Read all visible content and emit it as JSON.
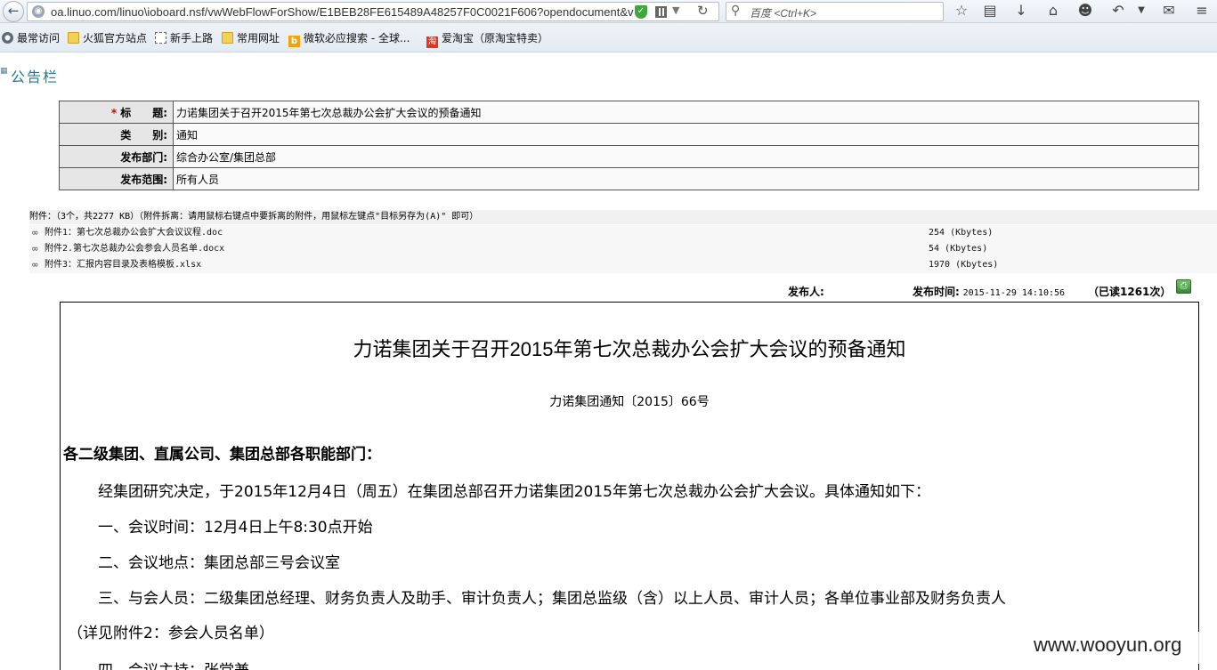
{
  "browser": {
    "url": "oa.linuo.com/linuo\\ioboard.nsf/vwWebFlowForShow/E1BEB28FE615489A48257F0C0021F606?opendocument&v",
    "search_placeholder": "百度 <Ctrl+K>",
    "bookmarks": [
      {
        "label": "最常访问",
        "icon": "gear-icon"
      },
      {
        "label": "火狐官方站点",
        "icon": "folder-icon"
      },
      {
        "label": "新手上路",
        "icon": "page-icon"
      },
      {
        "label": "常用网址",
        "icon": "folder-icon"
      },
      {
        "label": "微软必应搜索 - 全球...",
        "icon": "bing-icon"
      },
      {
        "label": "爱淘宝（原淘宝特卖）",
        "icon": "taobao-icon"
      }
    ],
    "taobao_icon_text": "淘"
  },
  "board": {
    "title": "公告栏"
  },
  "meta": {
    "rows": [
      {
        "label": "标　　题:",
        "value": "力诺集团关于召开2015年第七次总裁办公会扩大会议的预备通知",
        "required": "*"
      },
      {
        "label": "类　　别:",
        "value": "通知"
      },
      {
        "label": "发布部门:",
        "value": "综合办公室/集团总部"
      },
      {
        "label": "发布范围:",
        "value": "所有人员"
      }
    ]
  },
  "attachments": {
    "header": "附件：（3个，共2277 KB）（附件拆离：请用鼠标右键点中要拆离的附件，用鼠标左键点\"目标另存为(A)\" 即可）",
    "items": [
      {
        "name": "附件1：第七次总裁办公会扩大会议议程.doc",
        "size": "254 (Kbytes)"
      },
      {
        "name": "附件2.第七次总裁办公会参会人员名单.docx",
        "size": "54 (Kbytes)"
      },
      {
        "name": "附件3：汇报内容目录及表格模板.xlsx",
        "size": "1970 (Kbytes)"
      }
    ]
  },
  "publish": {
    "publisher_label": "发布人:",
    "time_label": "发布时间:",
    "time_value": "2015-11-29 14:10:56",
    "reads": "（已读1261次）"
  },
  "document": {
    "title": "力诺集团关于召开2015年第七次总裁办公会扩大会议的预备通知",
    "number": "力诺集团通知〔2015〕66号",
    "salutation": "各二级集团、直属公司、集团总部各职能部门：",
    "paragraphs": [
      "经集团研究决定，于2015年12月4日（周五）在集团总部召开力诺集团2015年第七次总裁办公会扩大会议。具体通知如下：",
      "一、会议时间：12月4日上午8:30点开始",
      "二、会议地点：集团总部三号会议室",
      "三、与会人员：二级集团总经理、财务负责人及助手、审计负责人；集团总监级（含）以上人员、审计人员；各单位事业部及财务负责人",
      "（详见附件2：参会人员名单）",
      "四、会议主持：张堂兼"
    ]
  },
  "watermark": "www.wooyun.org"
}
